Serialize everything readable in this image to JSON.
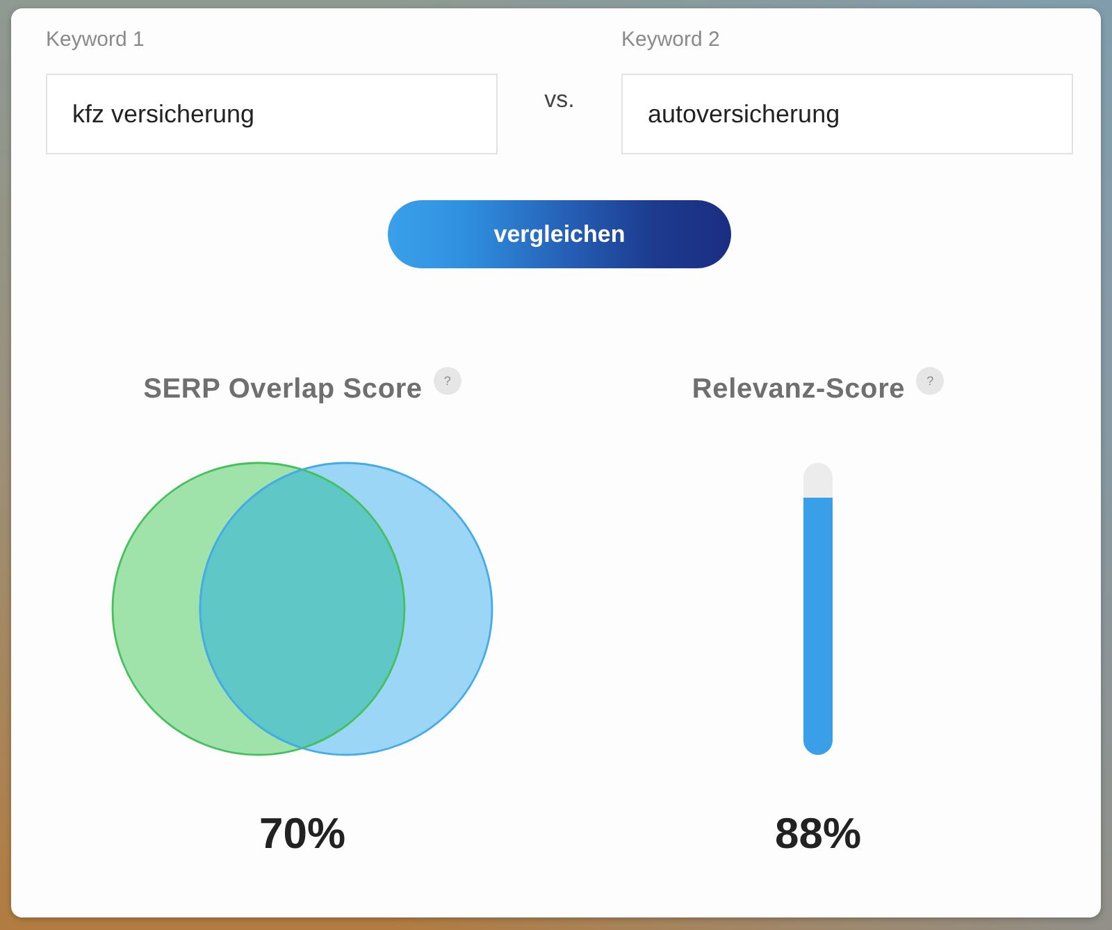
{
  "keywords": [
    {
      "label": "Keyword 1",
      "value": "kfz versicherung"
    },
    {
      "label": "Keyword 2",
      "value": "autoversicherung"
    }
  ],
  "separator": "vs.",
  "compare_button": "vergleichen",
  "scores": [
    {
      "kind": "venn",
      "title": "SERP Overlap Score",
      "help": "?",
      "level": 0.7,
      "value": "70%"
    },
    {
      "kind": "bar",
      "title": "Relevanz-Score",
      "help": "?",
      "level": 0.88,
      "value": "88%"
    }
  ]
}
